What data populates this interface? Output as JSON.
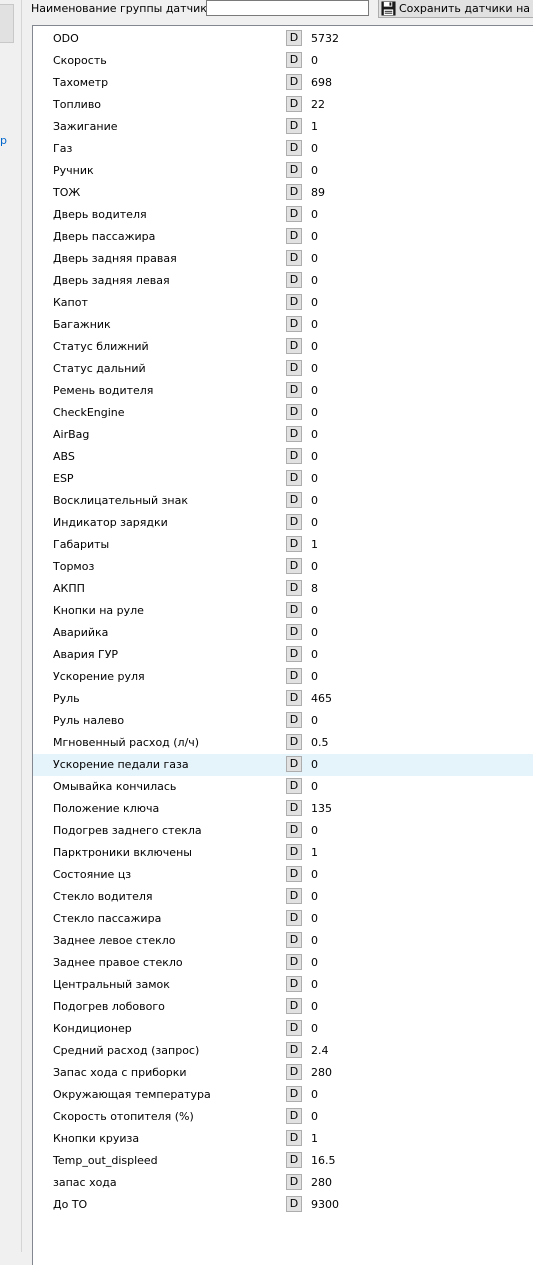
{
  "left": {
    "link_fragment": "р"
  },
  "header": {
    "group_name_label": "Наименование группы датчиков:",
    "group_name_value": "",
    "save_button_label": "Сохранить датчики на ус"
  },
  "sensors": {
    "button_label": "D",
    "rows": [
      {
        "name": "ODO",
        "value": "5732"
      },
      {
        "name": "Скорость",
        "value": "0"
      },
      {
        "name": "Тахометр",
        "value": "698"
      },
      {
        "name": "Топливо",
        "value": "22"
      },
      {
        "name": "Зажигание",
        "value": "1"
      },
      {
        "name": "Газ",
        "value": "0"
      },
      {
        "name": "Ручник",
        "value": "0"
      },
      {
        "name": "ТОЖ",
        "value": "89"
      },
      {
        "name": "Дверь водителя",
        "value": "0"
      },
      {
        "name": "Дверь пассажира",
        "value": "0"
      },
      {
        "name": "Дверь задняя правая",
        "value": "0"
      },
      {
        "name": "Дверь задняя левая",
        "value": "0"
      },
      {
        "name": "Капот",
        "value": "0"
      },
      {
        "name": "Багажник",
        "value": "0"
      },
      {
        "name": "Статус ближний",
        "value": "0"
      },
      {
        "name": "Статус дальний",
        "value": "0"
      },
      {
        "name": "Ремень водителя",
        "value": "0"
      },
      {
        "name": "CheckEngine",
        "value": "0"
      },
      {
        "name": "AirBag",
        "value": "0"
      },
      {
        "name": "ABS",
        "value": "0"
      },
      {
        "name": "ESP",
        "value": "0"
      },
      {
        "name": "Восклицательный знак",
        "value": "0"
      },
      {
        "name": "Индикатор зарядки",
        "value": "0"
      },
      {
        "name": "Габариты",
        "value": "1"
      },
      {
        "name": "Тормоз",
        "value": "0"
      },
      {
        "name": "АКПП",
        "value": "8"
      },
      {
        "name": "Кнопки на руле",
        "value": "0"
      },
      {
        "name": "Аварийка",
        "value": "0"
      },
      {
        "name": "Авария ГУР",
        "value": "0"
      },
      {
        "name": "Ускорение руля",
        "value": "0"
      },
      {
        "name": "Руль",
        "value": "465"
      },
      {
        "name": "Руль налево",
        "value": "0"
      },
      {
        "name": "Мгновенный расход (л/ч)",
        "value": "0.5"
      },
      {
        "name": "Ускорение педали газа",
        "value": "0",
        "selected": true
      },
      {
        "name": "Омывайка кончилась",
        "value": "0"
      },
      {
        "name": "Положение ключа",
        "value": "135"
      },
      {
        "name": "Подогрев заднего стекла",
        "value": "0"
      },
      {
        "name": "Парктроники включены",
        "value": "1"
      },
      {
        "name": "Состояние цз",
        "value": "0"
      },
      {
        "name": "Стекло водителя",
        "value": "0"
      },
      {
        "name": "Стекло пассажира",
        "value": "0"
      },
      {
        "name": "Заднее левое стекло",
        "value": "0"
      },
      {
        "name": "Заднее правое стекло",
        "value": "0"
      },
      {
        "name": "Центральный замок",
        "value": "0"
      },
      {
        "name": "Подогрев лобового",
        "value": "0"
      },
      {
        "name": "Кондиционер",
        "value": "0"
      },
      {
        "name": "Средний расход (запрос)",
        "value": "2.4"
      },
      {
        "name": "Запас хода с приборки",
        "value": "280"
      },
      {
        "name": "Окружающая температура",
        "value": "0"
      },
      {
        "name": "Скорость отопителя (%)",
        "value": "0"
      },
      {
        "name": "Кнопки круиза",
        "value": "1"
      },
      {
        "name": "Temp_out_displeed",
        "value": "16.5"
      },
      {
        "name": "запас хода",
        "value": "280"
      },
      {
        "name": "До ТО",
        "value": "9300"
      }
    ]
  }
}
